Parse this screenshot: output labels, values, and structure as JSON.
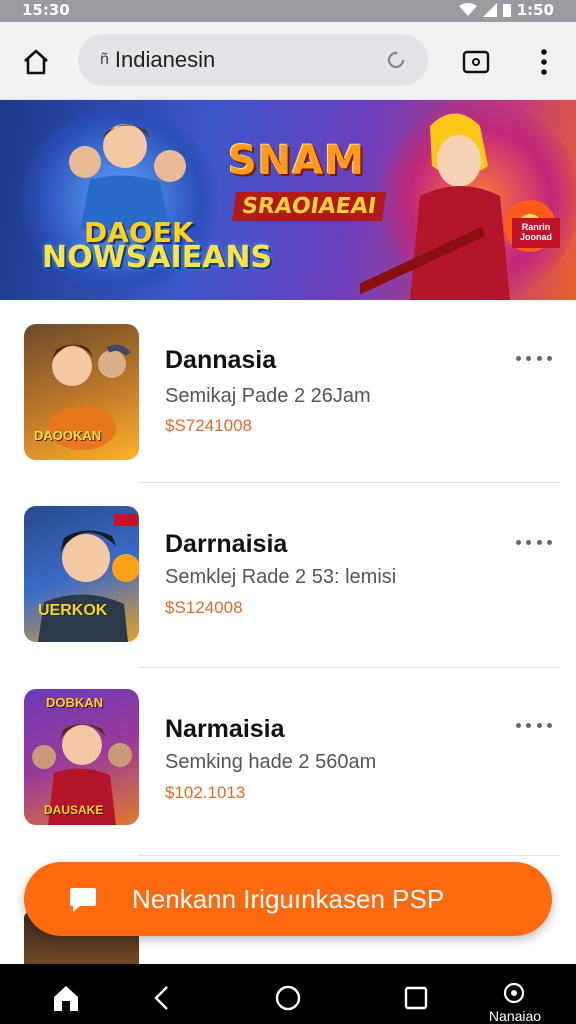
{
  "status_bar": {
    "time_left": "15:30",
    "time_right": "1:50"
  },
  "browser": {
    "url": "Indianesin",
    "home_icon": "home-icon",
    "reload_icon": "reload-icon",
    "tabs_icon": "tabs-icon",
    "menu_icon": "more-vert-icon"
  },
  "banner": {
    "title": "SNAM",
    "subtitle": "SRAOIAEAI",
    "logo_line1": "DAOEK",
    "logo_line2": "NOWSAIEANS",
    "badge": "Ranrin Joonad"
  },
  "items": [
    {
      "title": "Dannasia",
      "subtitle": "Semikaj Pade 2 26Jam",
      "price": "$S7241008",
      "thumb_text": "DAOOKAN"
    },
    {
      "title": "Darrnaisia",
      "subtitle": "Semklej Rade 2 53: lemisi",
      "price": "$S124008",
      "thumb_text": "UERKOK"
    },
    {
      "title": "Narmaisia",
      "subtitle": "Semking hade 2 560am",
      "price": "$102.1013",
      "thumb_text": "DAUSAKE",
      "thumb_top_text": "DOBKAN"
    }
  ],
  "cta": {
    "label": "Nenkann Iriguınkasen PSP",
    "icon": "chat-icon"
  },
  "nav": {
    "label": "Nanaiao",
    "icons": [
      "home-icon",
      "back-icon",
      "circle-home-icon",
      "recents-icon",
      "assistant-icon"
    ]
  },
  "colors": {
    "accent": "#ff6a10",
    "price": "#e06a2a"
  }
}
